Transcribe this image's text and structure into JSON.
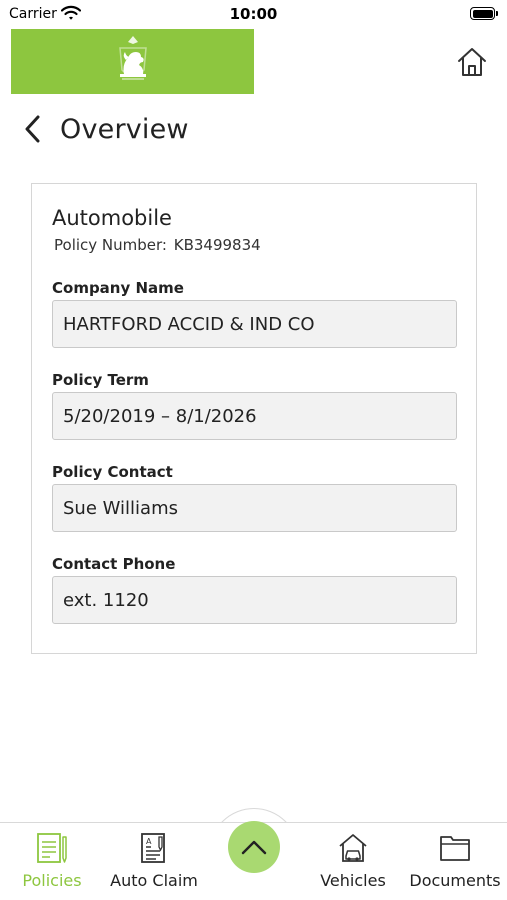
{
  "status_bar": {
    "carrier": "Carrier",
    "time": "10:00"
  },
  "header": {
    "brand_color": "#8dc63f",
    "logo_icon": "lion-crest-icon",
    "home_icon": "home-icon"
  },
  "nav": {
    "back_icon": "chevron-left-icon",
    "title": "Overview"
  },
  "policy": {
    "type": "Automobile",
    "number_label": "Policy Number:",
    "number": "KB3499834",
    "fields": [
      {
        "label": "Company Name",
        "value": "HARTFORD ACCID & IND CO"
      },
      {
        "label": "Policy Term",
        "value": "5/20/2019 – 8/1/2026"
      },
      {
        "label": "Policy Contact",
        "value": "Sue Williams"
      },
      {
        "label": "Contact Phone",
        "value": "ext. 1120"
      }
    ]
  },
  "tabbar": {
    "active_color": "#8dc63f",
    "center_button_color": "#a9d971",
    "center_icon": "chevron-up-icon",
    "tabs": [
      {
        "label": "Policies",
        "icon": "policy-document-icon",
        "active": true
      },
      {
        "label": "Auto Claim",
        "icon": "claim-form-icon",
        "active": false
      },
      {
        "label": "Vehicles",
        "icon": "house-car-icon",
        "active": false
      },
      {
        "label": "Documents",
        "icon": "folder-icon",
        "active": false
      }
    ]
  }
}
